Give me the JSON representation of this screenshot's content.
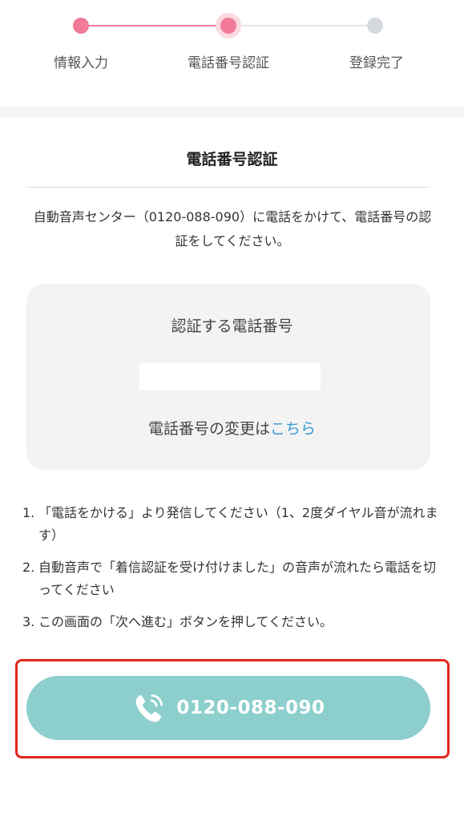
{
  "stepper": {
    "steps": [
      {
        "label": "情報入力",
        "state": "done"
      },
      {
        "label": "電話番号認証",
        "state": "current"
      },
      {
        "label": "登録完了",
        "state": "todo"
      }
    ],
    "colors": {
      "active": "#f07a98",
      "inactive": "#d5d8dd"
    }
  },
  "main": {
    "title": "電話番号認証",
    "intro": "自動音声センター（0120-088-090）に電話をかけて、電話番号の認証をしてください。"
  },
  "phone_card": {
    "heading": "認証する電話番号",
    "phone_number_value": "",
    "change_prefix": "電話番号の変更は",
    "change_link": "こちら"
  },
  "instructions": [
    {
      "number": "1.",
      "text": "「電話をかける」より発信してください（1、2度ダイヤル音が流れます）"
    },
    {
      "number": "2.",
      "text": "自動音声で「着信認証を受け付けました」の音声が流れたら電話を切ってください"
    },
    {
      "number": "3.",
      "text": "この画面の「次へ進む」ボタンを押してください。"
    }
  ],
  "call_button": {
    "icon": "phone-ringing-icon",
    "number": "0120-088-090",
    "color": "#8ccfcd",
    "highlight_color": "#e1261c"
  }
}
